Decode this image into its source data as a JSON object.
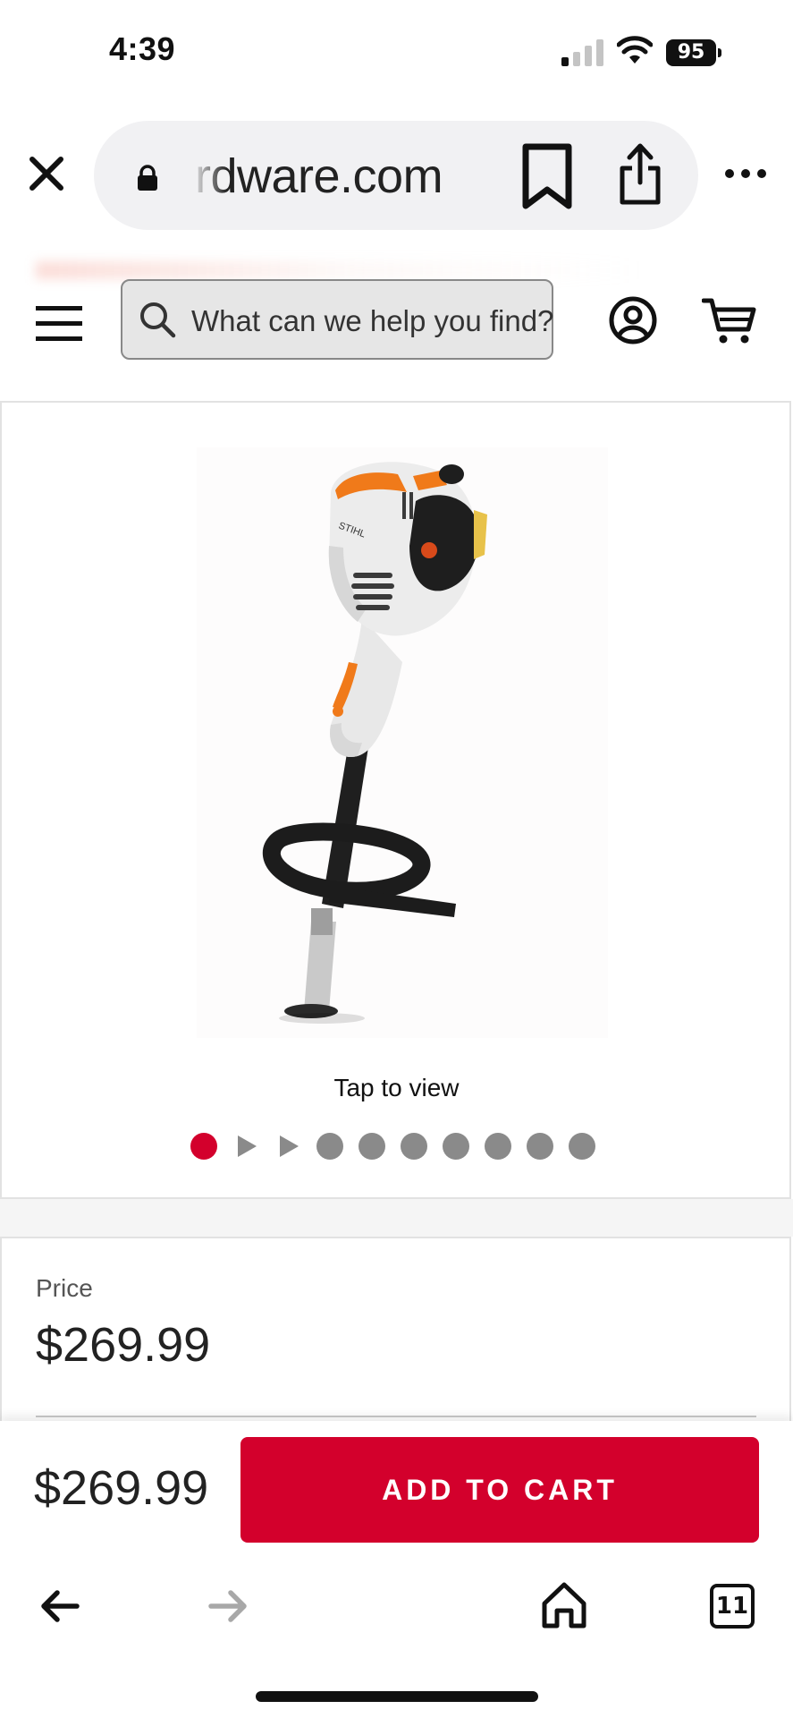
{
  "status_bar": {
    "time": "4:39",
    "battery": "95"
  },
  "browser": {
    "url_text": "rdware.com",
    "tab_count": "11"
  },
  "header": {
    "search_placeholder": "What can we help you find?"
  },
  "gallery": {
    "tap_text": "Tap to view",
    "active_index": 0,
    "indicators": [
      "dot",
      "video",
      "video",
      "dot",
      "dot",
      "dot",
      "dot",
      "dot",
      "dot",
      "dot"
    ]
  },
  "price_section": {
    "label": "Price",
    "amount": "$269.99"
  },
  "sticky_bar": {
    "price": "$269.99",
    "add_to_cart_label": "ADD TO CART"
  },
  "colors": {
    "brand_red": "#d3002c",
    "inactive_dot": "#8a8a8a"
  },
  "icons": {
    "close": "close-icon",
    "lock": "lock-icon",
    "bookmark": "bookmark-icon",
    "share": "share-icon",
    "more": "more-icon",
    "menu": "hamburger-icon",
    "search": "search-icon",
    "account": "account-icon",
    "cart": "cart-icon",
    "back": "back-arrow-icon",
    "forward": "forward-arrow-icon",
    "home": "home-icon",
    "tabs": "tabs-icon"
  }
}
